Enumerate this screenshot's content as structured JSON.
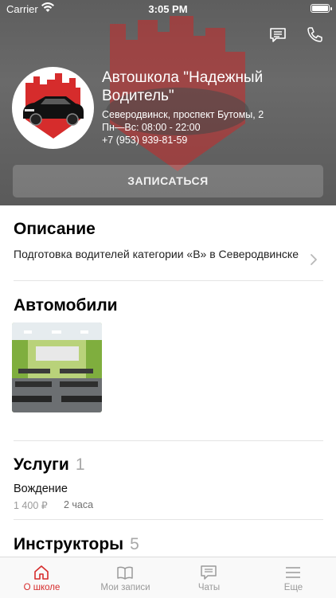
{
  "status_bar": {
    "carrier": "Carrier",
    "time": "3:05 PM"
  },
  "school": {
    "name": "Автошкола \"Надежный Водитель\"",
    "address": "Северодвинск, проспект Бутомы, 2",
    "hours": "Пн—Вс: 08:00 - 22:00",
    "phone": "+7 (953) 939-81-59"
  },
  "enroll_button": "ЗАПИСАТЬСЯ",
  "sections": {
    "description": {
      "title": "Описание",
      "text": "Подготовка водителей категории «В» в Северодвинске"
    },
    "cars": {
      "title": "Автомобили"
    },
    "services": {
      "title": "Услуги",
      "count": "1",
      "items": [
        {
          "name": "Вождение",
          "price": "1 400 ₽",
          "duration": "2 часа"
        }
      ]
    },
    "instructors": {
      "title": "Инструкторы",
      "count": "5"
    }
  },
  "tabs": [
    {
      "label": "О школе",
      "icon": "home-icon",
      "active": true
    },
    {
      "label": "Мои записи",
      "icon": "book-icon",
      "active": false
    },
    {
      "label": "Чаты",
      "icon": "chat-icon",
      "active": false
    },
    {
      "label": "Еще",
      "icon": "menu-icon",
      "active": false
    }
  ],
  "colors": {
    "accent": "#d62c2c",
    "header_bg": "#5e5e5e",
    "logo_red": "#d62c2c"
  }
}
